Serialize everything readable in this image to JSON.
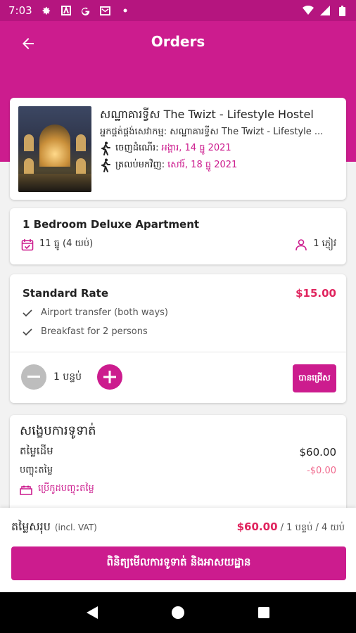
{
  "status_bar": {
    "time": "7:03",
    "icons": [
      "gear-icon",
      "a-notification-icon",
      "google-icon",
      "mail-icon",
      "dot-icon",
      "wifi-icon",
      "signal-icon",
      "battery-icon"
    ]
  },
  "header": {
    "title": "Orders",
    "back_icon": "arrow-left-icon"
  },
  "hotel": {
    "name": "សណ្ឋាគារទ្វីស The Twizt - Lifestyle Hostel",
    "provider": "អ្នកផ្គត់ផ្គង់សេវាកម្ម: សណ្ឋាគារទ្វីស The Twizt - Lifestyle ...",
    "checkin_label": "ចេញដំណើរ:",
    "checkin_value": "អង្គារ, 14 ធ្នូ 2021",
    "checkout_label": "ត្រលប់មកវិញ:",
    "checkout_value": "សៅរ៍, 18 ធ្នូ 2021"
  },
  "room": {
    "name": "1 Bedroom Deluxe Apartment",
    "date": "11 ធ្នូ (4 យប់)",
    "guests": "1 ភ្ញៀវ"
  },
  "rate": {
    "title": "Standard Rate",
    "price": "$15.00",
    "features": [
      "Airport transfer (both ways)",
      "Breakfast for 2 persons"
    ],
    "quantity": "1 បន្ទប់",
    "select_label": "បានជ្រើស"
  },
  "summary": {
    "title": "សង្ខេបការទូទាត់",
    "original_price_label": "តម្លៃដើម",
    "original_price": "$60.00",
    "discount_label": "បញ្ចុះតម្លៃ",
    "discount": "-$0.00",
    "promo_label": "ប្រើកូដបញ្ចុះតម្លៃ"
  },
  "footer": {
    "total_label": "តម្លៃសរុប",
    "vat_label": "(incl. VAT)",
    "total_amount": "$60.00",
    "total_suffix": " / 1 បន្ទប់ / 4 យប់",
    "primary_button": "ពិនិត្យមើលការទូទាត់ និងអាសយដ្ឋាន"
  },
  "colors": {
    "primary": "#cc1c8e",
    "status_bar": "#b5157f",
    "price": "#e0245e"
  }
}
